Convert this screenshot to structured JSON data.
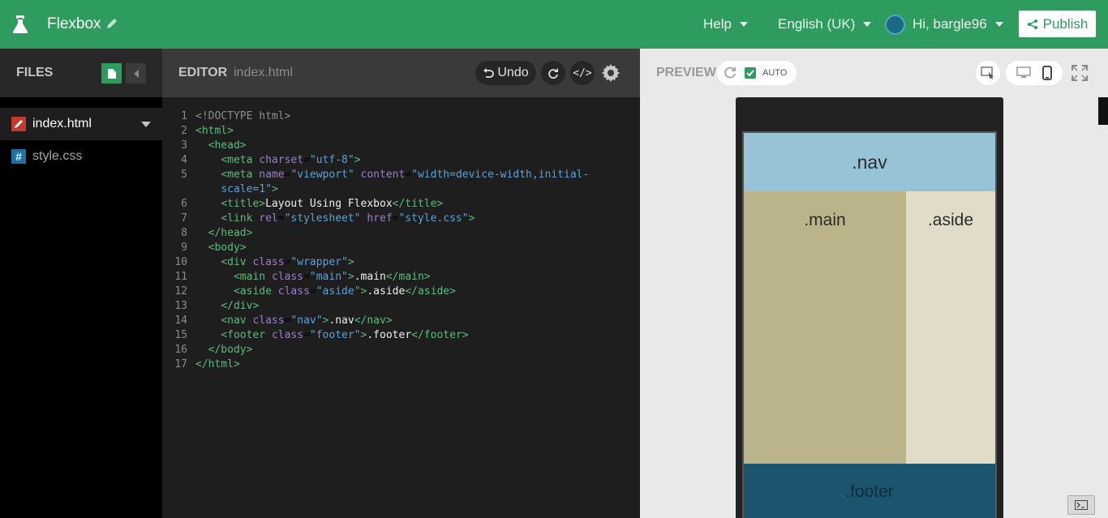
{
  "topbar": {
    "project_title": "Flexbox",
    "help_label": "Help",
    "language_label": "English (UK)",
    "user_greeting": "Hi, bargle96",
    "publish_label": "Publish"
  },
  "files": {
    "title": "FILES",
    "items": [
      {
        "name": "index.html",
        "type": "html"
      },
      {
        "name": "style.css",
        "type": "css"
      }
    ]
  },
  "editor": {
    "title": "EDITOR",
    "file": "index.html",
    "undo_label": "Undo",
    "code_toggle_label": "</>",
    "lines": [
      "1",
      "2",
      "3",
      "4",
      "5",
      "",
      "6",
      "7",
      "8",
      "9",
      "10",
      "11",
      "12",
      "13",
      "14",
      "15",
      "16",
      "17"
    ]
  },
  "preview": {
    "title": "PREVIEW",
    "auto_label": "AUTO",
    "sections": {
      "nav": ".nav",
      "main": ".main",
      "aside": ".aside",
      "footer": ".footer"
    }
  },
  "colors": {
    "brand_green": "#2e9b5f",
    "nav_bg": "#96c3d6",
    "main_bg": "#bbb38a",
    "aside_bg": "#e1dcc8",
    "footer_bg": "#1c536e"
  }
}
